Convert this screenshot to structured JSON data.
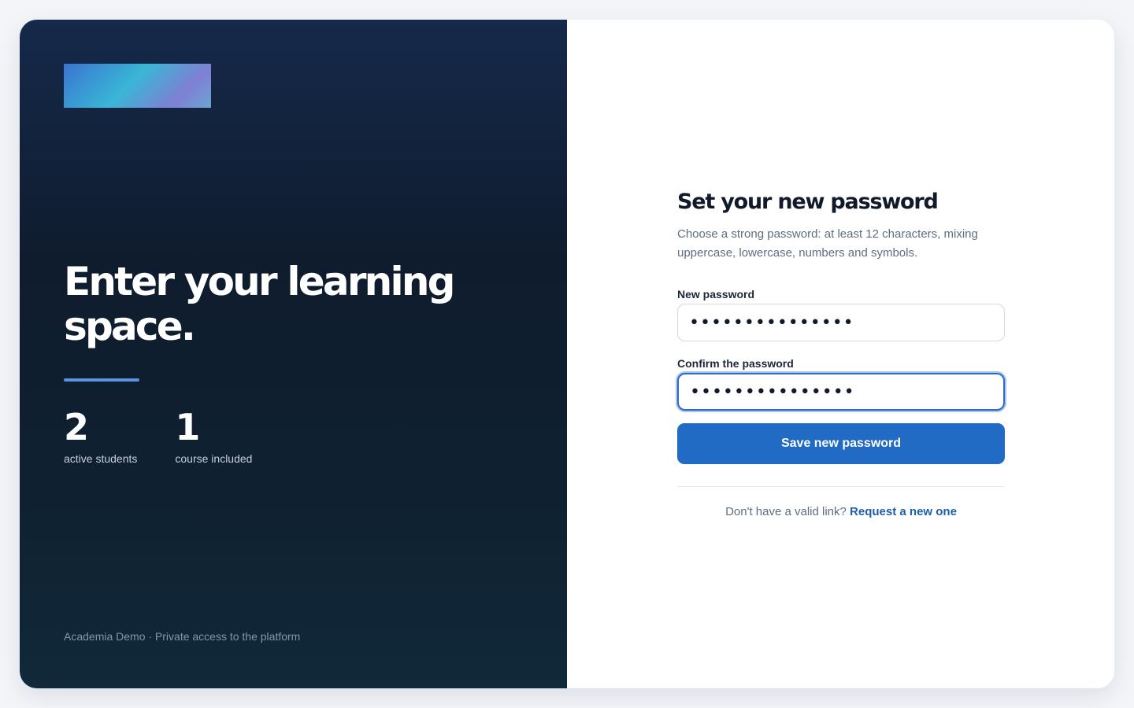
{
  "hero": {
    "title": "Enter your learning space.",
    "stats": [
      {
        "value": "2",
        "label": "active students"
      },
      {
        "value": "1",
        "label": "course included"
      }
    ],
    "footer": "Academia Demo · Private access to the platform"
  },
  "form": {
    "title": "Set your new password",
    "subtitle": "Choose a strong password: at least 12 characters, mixing uppercase, lowercase, numbers and symbols.",
    "new_password": {
      "label": "New password",
      "value": "•••••••••••••••"
    },
    "confirm_password": {
      "label": "Confirm the password",
      "value": "•••••••••••••••"
    },
    "submit_label": "Save new password",
    "help_text": "Don't have a valid link?",
    "help_link": "Request a new one"
  },
  "colors": {
    "accent": "#216bc4",
    "hero_background": "#0f1c2e",
    "link": "#1d5fae"
  }
}
